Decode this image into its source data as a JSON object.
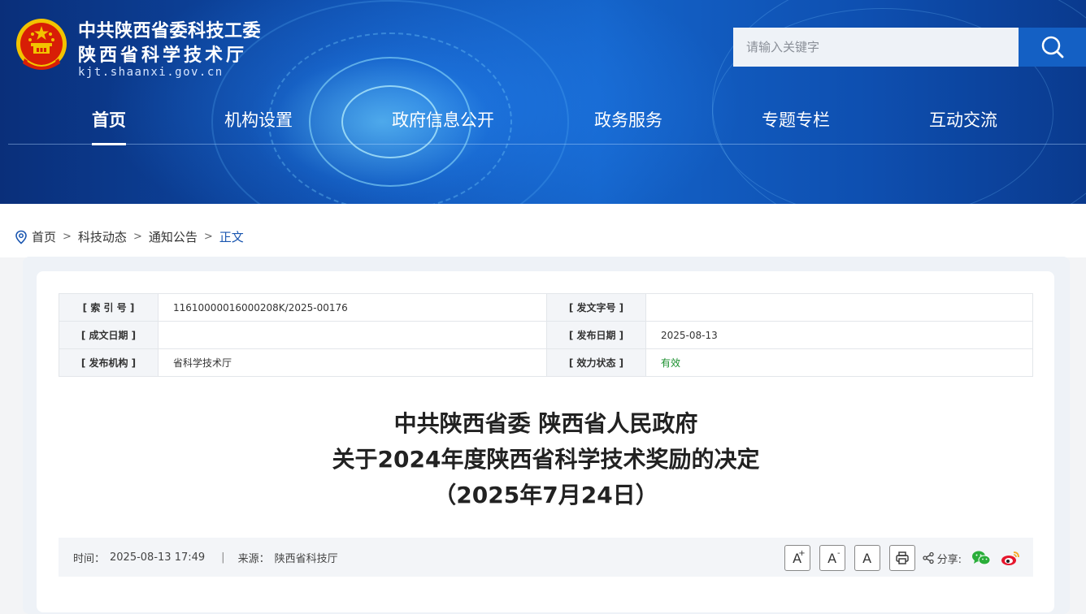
{
  "header": {
    "site_name_line1": "中共陕西省委科技工委",
    "site_name_line2": "陕西省科学技术厅",
    "domain": "kjt.shaanxi.gov.cn",
    "search_placeholder": "请输入关键字"
  },
  "nav": {
    "items": [
      {
        "label": "首页",
        "active": true
      },
      {
        "label": "机构设置"
      },
      {
        "label": "政府信息公开"
      },
      {
        "label": "政务服务"
      },
      {
        "label": "专题专栏"
      },
      {
        "label": "互动交流"
      }
    ]
  },
  "breadcrumb": {
    "items": [
      "首页",
      "科技动态",
      "通知公告",
      "正文"
    ],
    "separator": ">"
  },
  "meta": {
    "index_label": "[ 索 引 号 ]",
    "index_value": "11610000016000208K/2025-00176",
    "doc_no_label": "[ 发文字号 ]",
    "doc_no_value": "",
    "created_label": "[ 成文日期 ]",
    "created_value": "",
    "published_label": "[ 发布日期 ]",
    "published_value": "2025-08-13",
    "org_label": "[ 发布机构 ]",
    "org_value": "省科学技术厅",
    "status_label": "[ 效力状态 ]",
    "status_value": "有效",
    "status_color": "#1a8f2e"
  },
  "article": {
    "title_line1": "中共陕西省委 陕西省人民政府",
    "title_line2": "关于2024年度陕西省科学技术奖励的决定",
    "title_line3": "（2025年7月24日）",
    "time_label": "时间：",
    "time_value": "2025-08-13 17:49",
    "divider": "|",
    "source_label": "来源：",
    "source_value": "陕西省科技厅"
  },
  "tools": {
    "font_larger": "A",
    "font_larger_sup": "+",
    "font_smaller": "A",
    "font_smaller_sup": "-",
    "font_default": "A",
    "share_label": "分享:",
    "icons": [
      "print-icon",
      "share-icon",
      "wechat-icon",
      "weibo-icon"
    ]
  },
  "colors": {
    "brand_blue": "#1460c4",
    "link_current": "#1a56b0"
  }
}
